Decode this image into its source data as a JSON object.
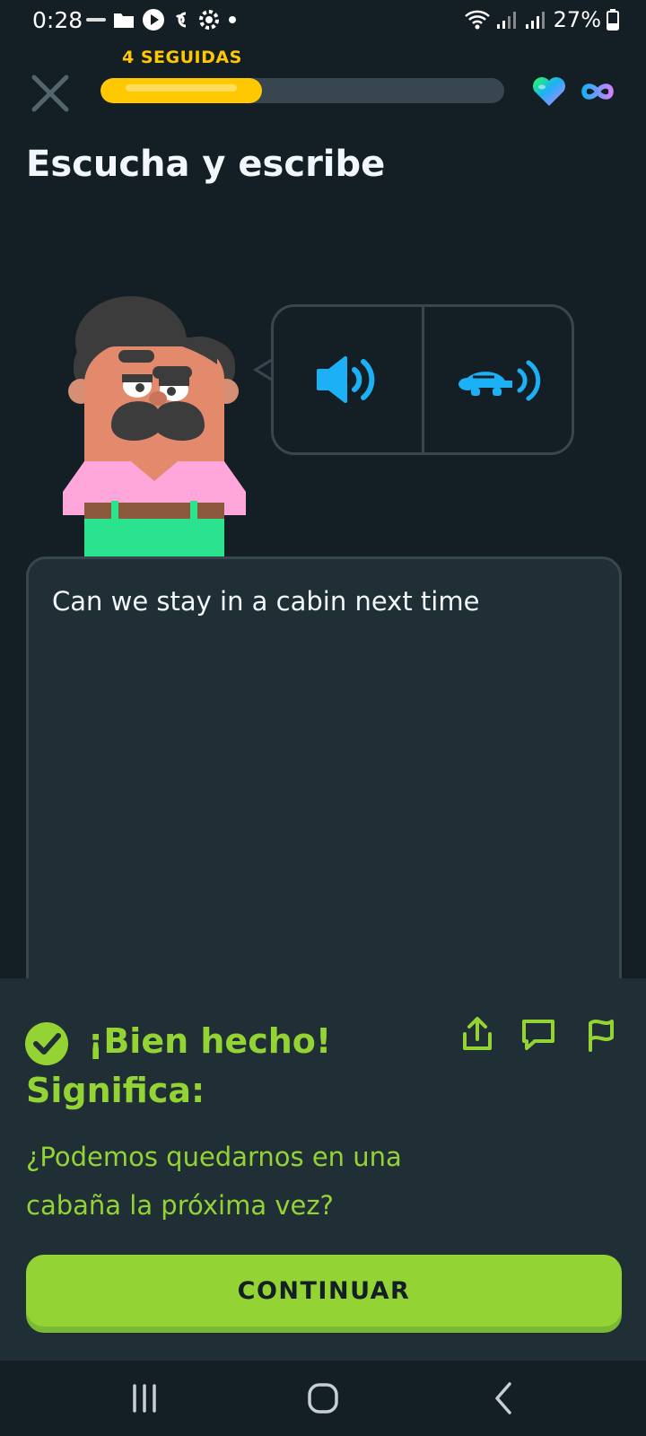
{
  "status_bar": {
    "time": "0:28",
    "battery": "27%"
  },
  "header": {
    "streak": "4 SEGUIDAS",
    "progress": 0.4,
    "hearts": "infinite"
  },
  "exercise": {
    "title": "Escucha y escribe",
    "answer": "Can we stay in a cabin next time"
  },
  "feedback": {
    "title": "¡Bien hecho!",
    "meaning_label": "Significa:",
    "translation": "¿Podemos quedarnos en una cabaña la próxima vez?",
    "continue_label": "CONTINUAR"
  },
  "colors": {
    "background": "#131f24",
    "panel": "#202f36",
    "streak": "#ffc800",
    "audio": "#1cb0f6",
    "success": "#93d333"
  },
  "icons": {
    "close": "close-icon",
    "audio": "speaker-icon",
    "slow_audio": "turtle-speaker-icon",
    "report": "flag-icon",
    "discuss": "comment-icon",
    "share": "share-icon"
  }
}
